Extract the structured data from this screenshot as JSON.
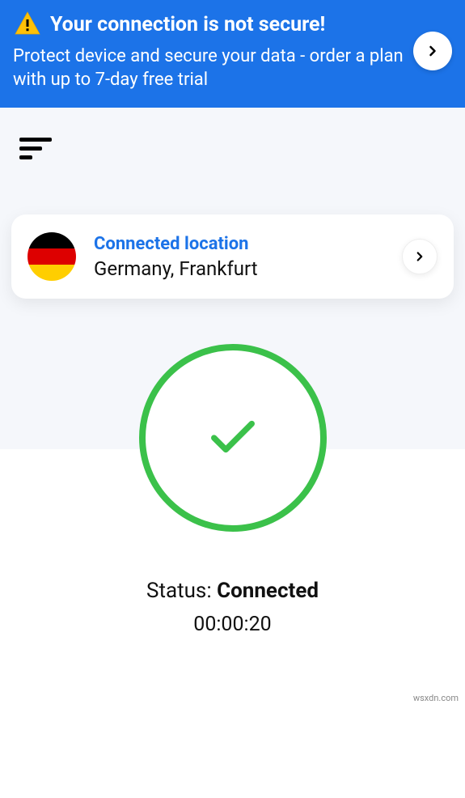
{
  "banner": {
    "title": "Your connection is not secure!",
    "subtitle": "Protect device and secure your data - order a plan with up to 7-day free trial"
  },
  "location": {
    "label": "Connected location",
    "value": "Germany, Frankfurt",
    "flag": "germany"
  },
  "status": {
    "label": "Status: ",
    "value": "Connected",
    "timer": "00:00:20"
  },
  "colors": {
    "primary": "#1c73e8",
    "success": "#3bc14a"
  },
  "watermark": "wsxdn.com"
}
